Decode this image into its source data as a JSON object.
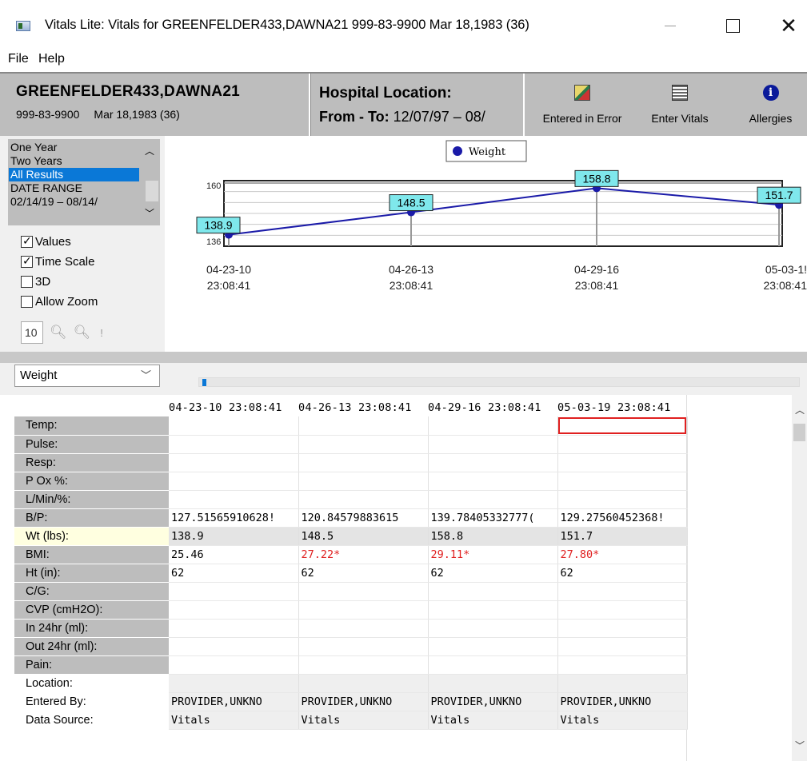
{
  "window": {
    "title": "Vitals Lite: Vitals for GREENFELDER433,DAWNA21 999-83-9900   Mar 18,1983 (36)",
    "minimize_icon": "minimize-icon",
    "maximize_icon": "maximize-icon",
    "close_label": "✕"
  },
  "menu": [
    "File",
    "Help"
  ],
  "patient": {
    "name": "GREENFELDER433,DAWNA21",
    "ssn": "999-83-9900",
    "dob": "Mar 18,1983 (36)"
  },
  "location": {
    "title": "Hospital Location:",
    "range_label": "From - To:",
    "range_value": "12/07/97 – 08/"
  },
  "toolbar": {
    "entered_in_error": "Entered in Error",
    "enter_vitals": "Enter Vitals",
    "allergies": "Allergies"
  },
  "date_ranges": [
    "One Year",
    "Two Years",
    "All Results",
    "DATE RANGE",
    "02/14/19 – 08/14/"
  ],
  "selected_range": "All Results",
  "options": {
    "values": "Values",
    "time_scale": "Time Scale",
    "three_d": "3D",
    "allow_zoom": "Allow Zoom",
    "zoom_value": "10",
    "values_checked": true,
    "time_scale_checked": true,
    "three_d_checked": false,
    "allow_zoom_checked": false
  },
  "chart_data": {
    "type": "line",
    "legend": [
      "Weight"
    ],
    "series": [
      {
        "name": "Weight",
        "values": [
          138.9,
          148.5,
          158.8,
          151.7
        ]
      }
    ],
    "x": [
      "04-23-10 23:08:41",
      "04-26-13 23:08:41",
      "04-29-16 23:08:41",
      "05-03-19 23:08:41"
    ],
    "x_tick_dates": [
      "04-23-10",
      "04-26-13",
      "04-29-16",
      "05-03-1!"
    ],
    "x_tick_times": [
      "23:08:41",
      "23:08:41",
      "23:08:41",
      "23:08:41"
    ],
    "y_ticks": [
      "160",
      "136"
    ],
    "ylim": [
      134,
      162
    ],
    "color": "#1a1aa8",
    "label_bg": "#7fe8ec"
  },
  "selector": {
    "value": "Weight"
  },
  "grid": {
    "columns": [
      "04-23-10 23:08:41",
      "04-26-13 23:08:41",
      "04-29-16 23:08:41",
      "05-03-19 23:08:41"
    ],
    "rows": [
      {
        "label": "Temp:",
        "values": [
          "",
          "",
          "",
          ""
        ]
      },
      {
        "label": "Pulse:",
        "values": [
          "",
          "",
          "",
          ""
        ]
      },
      {
        "label": "Resp:",
        "values": [
          "",
          "",
          "",
          ""
        ]
      },
      {
        "label": "P Ox %:",
        "values": [
          "",
          "",
          "",
          ""
        ]
      },
      {
        "label": "L/Min/%:",
        "values": [
          "",
          "",
          "",
          ""
        ]
      },
      {
        "label": "B/P:",
        "values": [
          "127.51565910628!",
          "120.84579883615",
          "139.78405332777(",
          "129.27560452368!"
        ]
      },
      {
        "label": "Wt (lbs):",
        "values": [
          "138.9",
          "148.5",
          "158.8",
          "151.7"
        ]
      },
      {
        "label": "BMI:",
        "values": [
          "25.46",
          "27.22*",
          "29.11*",
          "27.80*"
        ]
      },
      {
        "label": "Ht (in):",
        "values": [
          "62",
          "62",
          "62",
          "62"
        ]
      },
      {
        "label": "C/G:",
        "values": [
          "",
          "",
          "",
          ""
        ]
      },
      {
        "label": "CVP (cmH2O):",
        "values": [
          "",
          "",
          "",
          ""
        ]
      },
      {
        "label": "In 24hr (ml):",
        "values": [
          "",
          "",
          "",
          ""
        ]
      },
      {
        "label": "Out 24hr (ml):",
        "values": [
          "",
          "",
          "",
          ""
        ]
      },
      {
        "label": "Pain:",
        "values": [
          "",
          "",
          "",
          ""
        ]
      },
      {
        "label": "Location:",
        "values": [
          "",
          "",
          "",
          ""
        ]
      },
      {
        "label": "Entered By:",
        "values": [
          "PROVIDER,UNKNO",
          "PROVIDER,UNKNO",
          "PROVIDER,UNKNO",
          "PROVIDER,UNKNO"
        ]
      },
      {
        "label": "Data Source:",
        "values": [
          "Vitals",
          "Vitals",
          "Vitals",
          "Vitals"
        ]
      }
    ]
  }
}
